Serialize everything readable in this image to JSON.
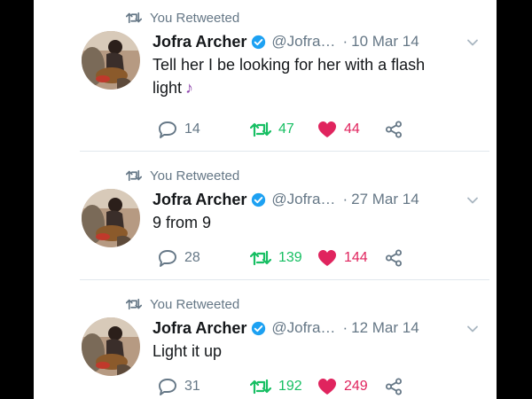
{
  "colors": {
    "retweet_green": "#17bf63",
    "like_red": "#e0245e",
    "muted_gray": "#657786",
    "verified_blue": "#1da1f2"
  },
  "tweets": [
    {
      "retweet_label": "You Retweeted",
      "name": "Jofra Archer",
      "handle": "@Jofra…",
      "date": "10 Mar 14",
      "text": "Tell her I be looking for her with a flash light",
      "emoji": "♪",
      "replies": "14",
      "retweets": "47",
      "likes": "44"
    },
    {
      "retweet_label": "You Retweeted",
      "name": "Jofra Archer",
      "handle": "@Jofra…",
      "date": "27 Mar 14",
      "text": "9 from 9",
      "replies": "28",
      "retweets": "139",
      "likes": "144"
    },
    {
      "retweet_label": "You Retweeted",
      "name": "Jofra Archer",
      "handle": "@Jofra…",
      "date": "12 Mar 14",
      "text": "Light it up",
      "replies": "31",
      "retweets": "192",
      "likes": "249"
    }
  ]
}
